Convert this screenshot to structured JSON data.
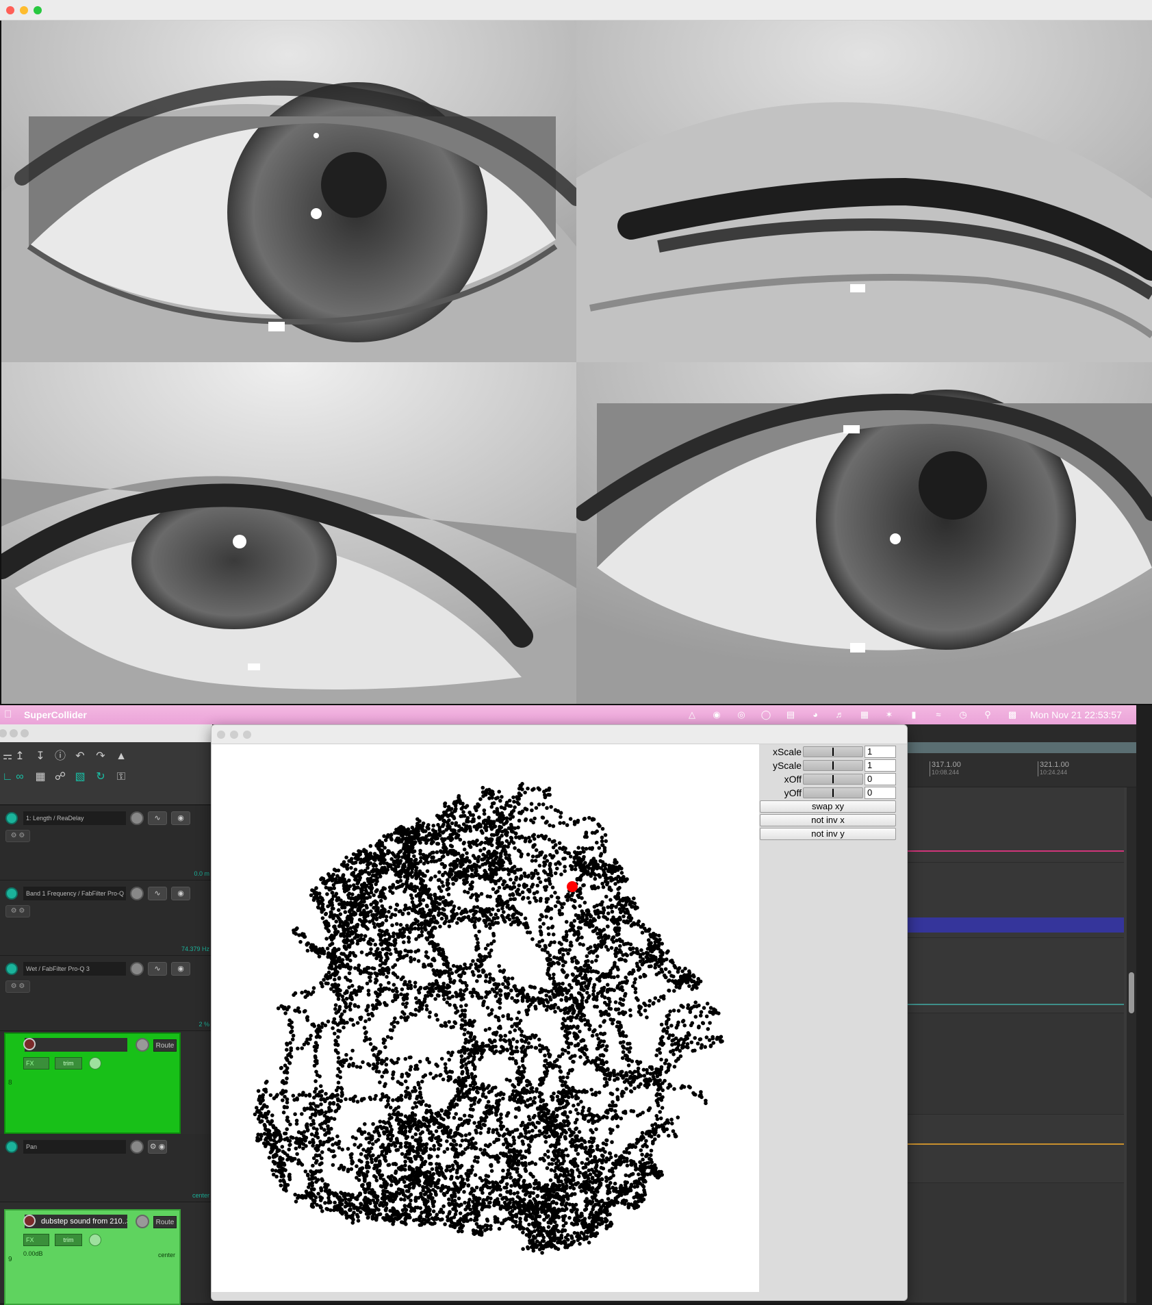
{
  "menubar": {
    "app_name": "SuperCollider",
    "clock": "Mon Nov 21  22:53:57",
    "status_icons": [
      "notification-icon",
      "eye-icon",
      "sw-badge-icon",
      "cc-icon",
      "bed-icon",
      "headphones-icon",
      "volume-icon",
      "calendar-icon",
      "bluetooth-icon",
      "battery-icon",
      "wifi-icon",
      "time-machine-icon",
      "search-icon",
      "control-center-icon"
    ]
  },
  "eye_window": {
    "panels": [
      "eye-top-left",
      "eye-top-right",
      "eye-bottom-left",
      "eye-bottom-right"
    ]
  },
  "daw": {
    "envelopes": [
      {
        "name": "1: Length / ReaDelay",
        "value": "0.0 m"
      },
      {
        "name": "Band 1 Frequency / FabFilter Pro-Q 3",
        "value": "74.379 Hz"
      },
      {
        "name": "Wet / FabFilter Pro-Q 3",
        "value": "2 %"
      },
      {
        "name": "Pan",
        "value": "center"
      }
    ],
    "tracks": [
      {
        "number": "8",
        "name": "",
        "route_label": "Route",
        "fx_label": "FX",
        "trim_label": "trim"
      },
      {
        "number": "9",
        "name": "dubstep sound from 210..39",
        "route_label": "Route",
        "fx_label": "FX",
        "trim_label": "trim",
        "volume": "0.00dB",
        "pan": "center"
      }
    ],
    "ruler": [
      {
        "bar": "317.1.00",
        "time": "10:08.244"
      },
      {
        "bar": "321.1.00",
        "time": "10:24.244"
      }
    ]
  },
  "sc_window": {
    "controls": [
      {
        "label": "xScale",
        "value": "1",
        "level": 0.5
      },
      {
        "label": "yScale",
        "value": "1",
        "level": 0.5
      },
      {
        "label": "xOff",
        "value": "0",
        "level": 0.5
      },
      {
        "label": "yOff",
        "value": "0",
        "level": 0.5
      }
    ],
    "buttons": {
      "swap": "swap xy",
      "inv_x": "not inv x",
      "inv_y": "not inv y"
    },
    "highlight_color": "#ff0000",
    "point_color": "#000000"
  }
}
